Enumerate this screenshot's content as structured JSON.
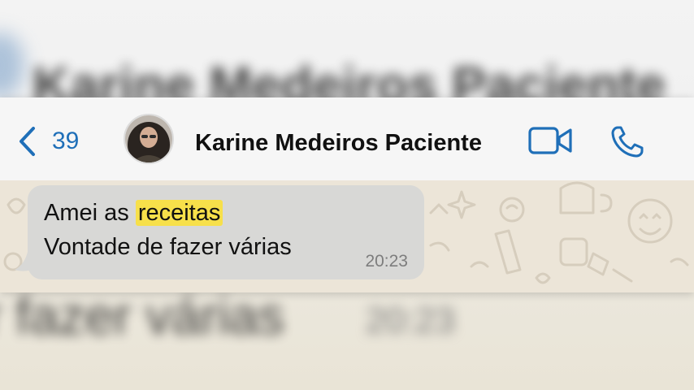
{
  "header": {
    "back_count": "39",
    "contact_name": "Karine Medeiros Paciente",
    "accent_color": "#1f6fb8"
  },
  "message": {
    "text_before_highlight": "Amei as ",
    "highlight": "receitas",
    "line2": "Vontade de fazer várias",
    "time": "20:23",
    "highlight_color": "#f7e04a"
  },
  "background": {
    "title_blurred": "Karine Medeiros Paciente",
    "text_blurred": "r fazer várias",
    "time_blurred": "20:23"
  },
  "icons": {
    "back": "chevron-left-icon",
    "video": "video-camera-icon",
    "call": "phone-icon"
  }
}
